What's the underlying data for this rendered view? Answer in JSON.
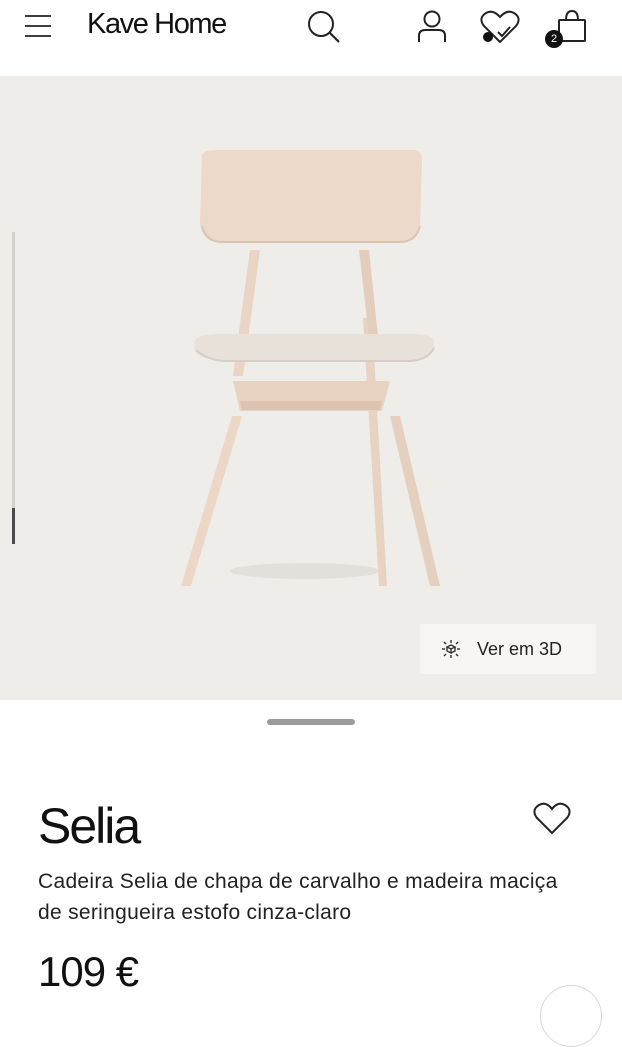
{
  "header": {
    "logo": "Kave Home",
    "cart_count": "2",
    "icons": [
      "menu-icon",
      "search-icon",
      "user-icon",
      "wishlist-icon",
      "cart-icon"
    ]
  },
  "gallery": {
    "view_3d_label": "Ver em 3D",
    "image_alt": "chair"
  },
  "product": {
    "name": "Selia",
    "description": "Cadeira Selia de chapa de carvalho e madeira maciça de seringueira estofo cinza-claro",
    "price": "109 €"
  },
  "colors": {
    "background": "#efedea",
    "text": "#111111",
    "badge": "#111111",
    "wood": "#ead6c6",
    "fabric": "#e6e0d8"
  }
}
